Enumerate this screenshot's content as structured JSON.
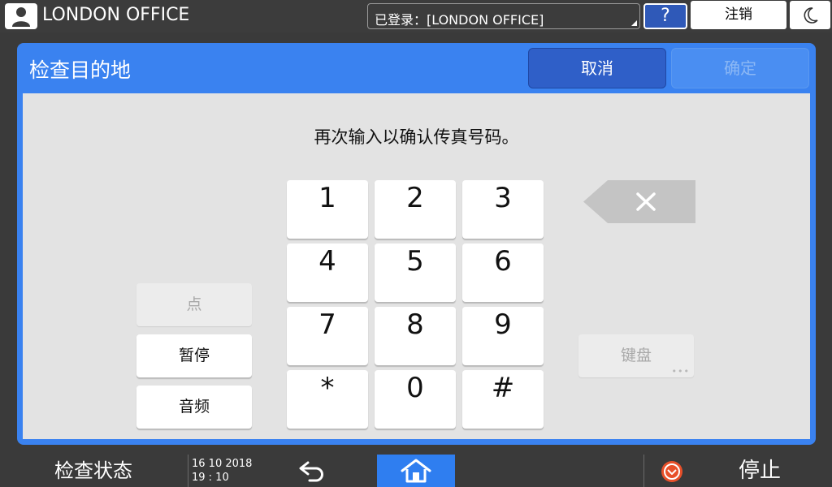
{
  "topbar": {
    "office_name": "LONDON OFFICE",
    "login_text": "已登录：[LONDON OFFICE]",
    "help_label": "?",
    "logout_label": "注销"
  },
  "dialog": {
    "title": "检查目的地",
    "cancel_label": "取消",
    "ok_label": "确定",
    "message": "再次输入以确认传真号码。"
  },
  "keypad": {
    "keys": [
      "1",
      "2",
      "3",
      "4",
      "5",
      "6",
      "7",
      "8",
      "9",
      "*",
      "0",
      "#"
    ]
  },
  "side_buttons": {
    "dot_label": "点",
    "pause_label": "暂停",
    "tone_label": "音频",
    "keyboard_label": "键盘"
  },
  "bottombar": {
    "status_label": "检查状态",
    "date": "16 10 2018",
    "time": "19 : 10",
    "stop_label": "停止"
  }
}
